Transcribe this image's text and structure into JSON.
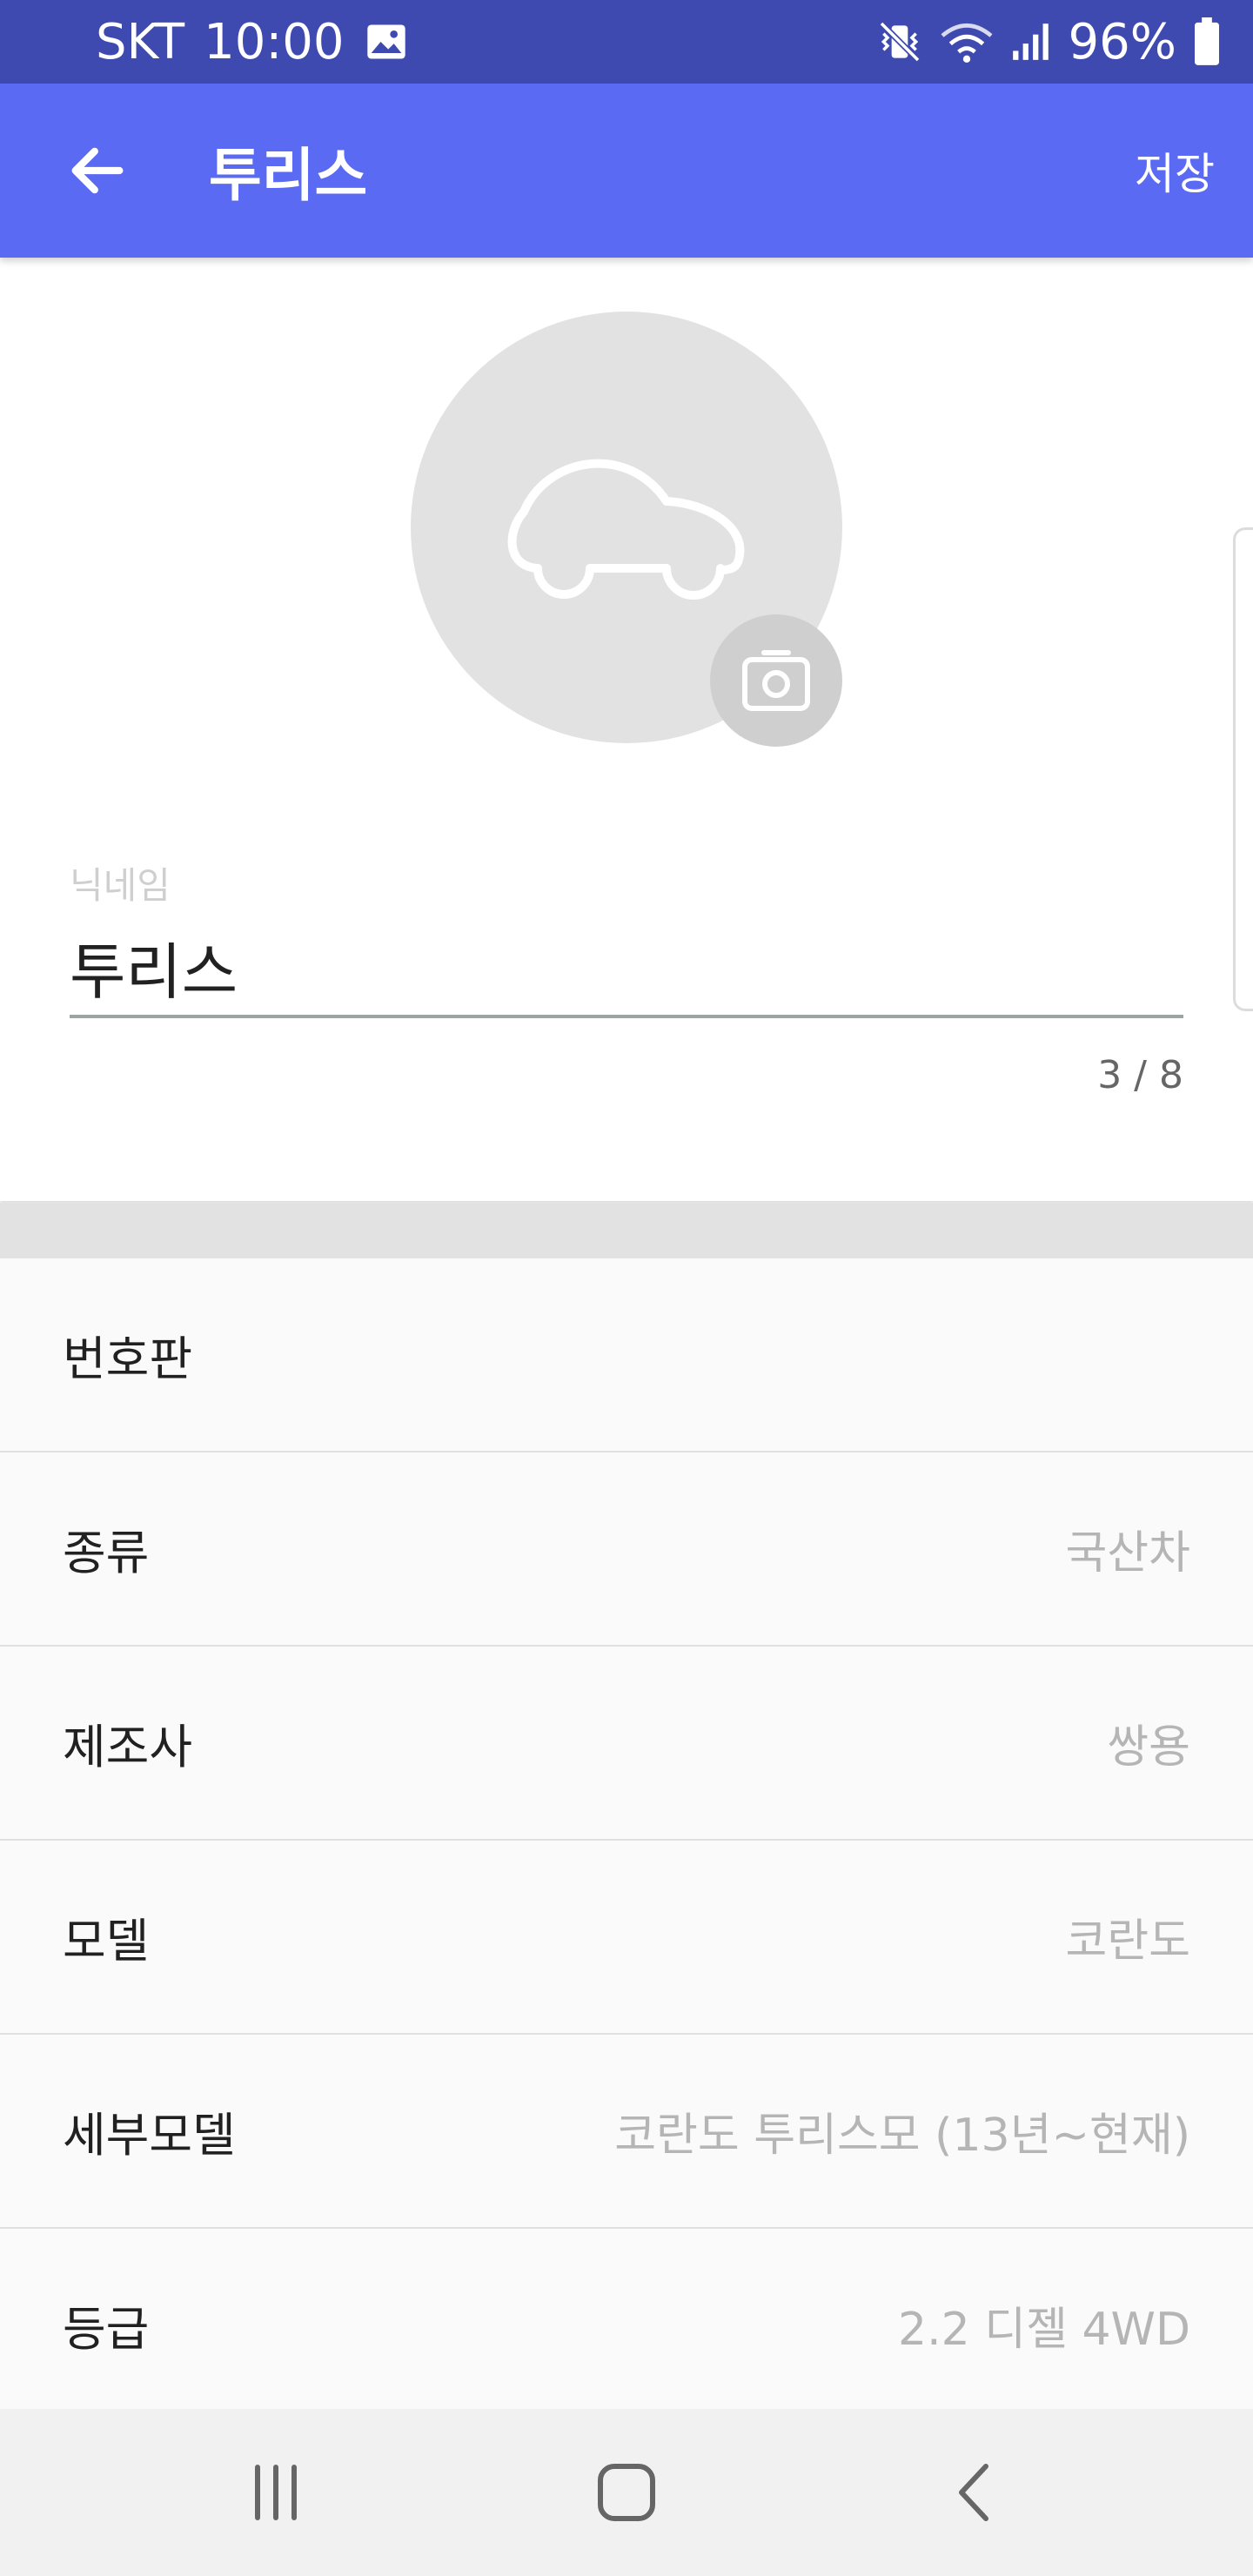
{
  "status_bar": {
    "carrier": "SKT",
    "time": "10:00",
    "battery": "96%",
    "icons": [
      "gallery-icon",
      "vibrate-icon",
      "wifi-icon",
      "signal-icon",
      "battery-icon"
    ]
  },
  "app_bar": {
    "title": "투리스",
    "save_label": "저장",
    "back_icon": "arrow-back-icon"
  },
  "profile": {
    "avatar_icon": "car-icon",
    "camera_icon": "camera-icon",
    "nickname_label": "닉네임",
    "nickname_value": "투리스",
    "char_counter": "3 / 8"
  },
  "info": {
    "rows": [
      {
        "label": "번호판",
        "value": ""
      },
      {
        "label": "종류",
        "value": "국산차"
      },
      {
        "label": "제조사",
        "value": "쌍용"
      },
      {
        "label": "모델",
        "value": "코란도"
      },
      {
        "label": "세부모델",
        "value": "코란도 투리스모 (13년~현재)"
      },
      {
        "label": "등급",
        "value": "2.2 디젤 4WD"
      }
    ]
  },
  "nav_bar": {
    "icons": [
      "recent-apps-icon",
      "home-icon",
      "back-icon"
    ]
  },
  "colors": {
    "status_bar": "#3f4ab0",
    "app_bar": "#5b6af3",
    "label_text": "#212121",
    "value_text": "#b5b5b5"
  }
}
